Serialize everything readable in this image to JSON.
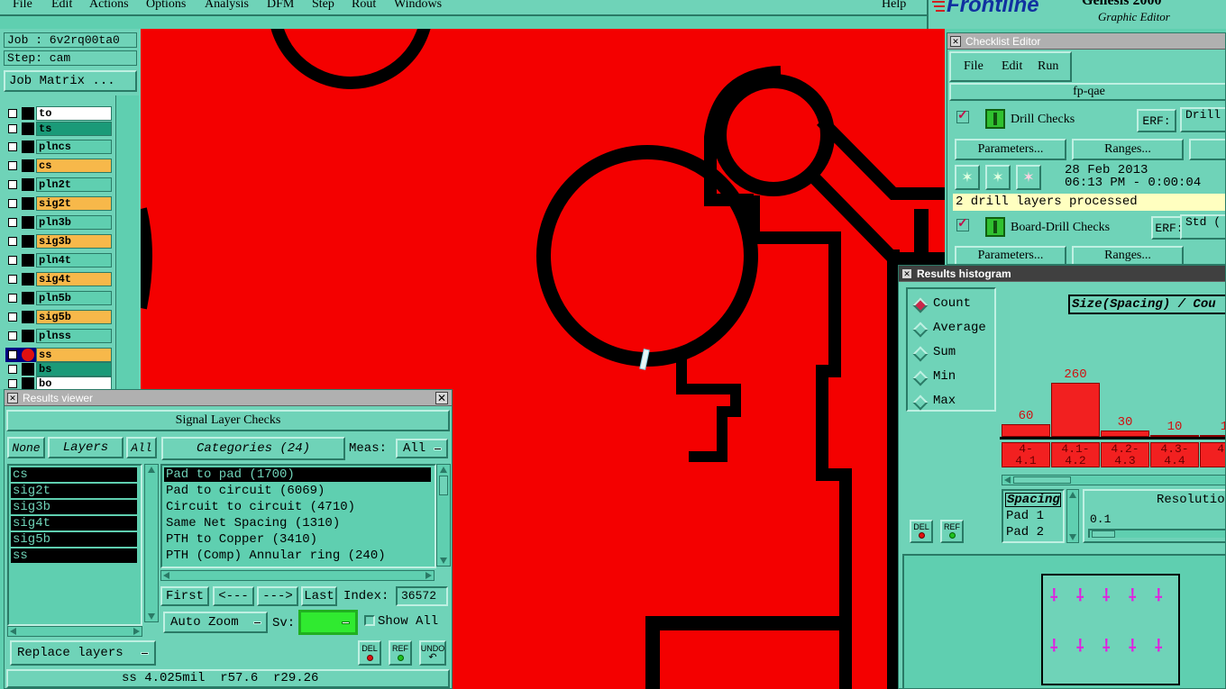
{
  "menubar": {
    "items": [
      "File",
      "Edit",
      "Actions",
      "Options",
      "Analysis",
      "DFM",
      "Step",
      "Rout",
      "Windows"
    ],
    "help": "Help"
  },
  "logo": {
    "brand": "Frontline",
    "product": "Genesis 2000",
    "subtitle": "Graphic Editor"
  },
  "left": {
    "job_label": "Job : 6v2rq00ta0",
    "step_label": "Step: cam",
    "job_matrix_button": "Job Matrix ...",
    "layers": [
      {
        "name": "to",
        "color": "#ffffff",
        "active": false
      },
      {
        "name": "ts",
        "color": "#1a9a78",
        "active": false
      },
      {
        "name": "plncs",
        "color": "#5fcfb0",
        "active": false
      },
      {
        "name": "cs",
        "color": "#f7b84a",
        "active": false
      },
      {
        "name": "pln2t",
        "color": "#5fcfb0",
        "active": false
      },
      {
        "name": "sig2t",
        "color": "#f7b84a",
        "active": false
      },
      {
        "name": "pln3b",
        "color": "#5fcfb0",
        "active": false
      },
      {
        "name": "sig3b",
        "color": "#f7b84a",
        "active": false
      },
      {
        "name": "pln4t",
        "color": "#5fcfb0",
        "active": false
      },
      {
        "name": "sig4t",
        "color": "#f7b84a",
        "active": false
      },
      {
        "name": "pln5b",
        "color": "#5fcfb0",
        "active": false
      },
      {
        "name": "sig5b",
        "color": "#f7b84a",
        "active": false
      },
      {
        "name": "plnss",
        "color": "#5fcfb0",
        "active": false
      },
      {
        "name": "ss",
        "color": "#f7b84a",
        "active": true
      },
      {
        "name": "bs",
        "color": "#1a9a78",
        "active": false
      },
      {
        "name": "bo",
        "color": "#ffffff",
        "active": false
      }
    ]
  },
  "results_viewer": {
    "title": "Results viewer",
    "check_name": "Signal Layer Checks",
    "none_btn": "None",
    "layers_btn": "Layers",
    "all_btn": "All",
    "categories_btn": "Categories (24)",
    "meas_label": "Meas:",
    "meas_value": "All",
    "layer_list": [
      "cs",
      "sig2t",
      "sig3b",
      "sig4t",
      "sig5b",
      "ss"
    ],
    "categories": [
      "Pad to pad (1700)",
      "Pad to circuit (6069)",
      "Circuit to circuit (4710)",
      "Same Net Spacing (1310)",
      "PTH to Copper (3410)",
      "PTH (Comp) Annular ring (240)"
    ],
    "first_btn": "First",
    "prev_btn": "<---",
    "next_btn": "--->",
    "last_btn": "Last",
    "index_label": "Index:",
    "index_value": "36572",
    "auto_zoom": "Auto Zoom",
    "sv_label": "Sv:",
    "show_all": "Show All",
    "replace_layers": "Replace layers",
    "del": "DEL",
    "ref": "REF",
    "undo": "UNDO",
    "status": "ss 4.025mil  r57.6  r29.26"
  },
  "checklist_editor": {
    "title": "Checklist Editor",
    "menu": [
      "File",
      "Edit",
      "Run"
    ],
    "checklist_name": "fp-qae",
    "checks": [
      {
        "name": "Drill Checks",
        "erf": "ERF:",
        "erf_value": "Drill",
        "params": "Parameters...",
        "ranges": "Ranges...",
        "date": "28 Feb 2013",
        "time": "06:13 PM - 0:00:04",
        "message": "2 drill layers processed"
      },
      {
        "name": "Board-Drill Checks",
        "erf": "ERF:",
        "erf_value": "Std (",
        "params": "Parameters...",
        "ranges": "Ranges..."
      }
    ]
  },
  "histogram": {
    "title": "Results histogram",
    "modes": [
      "Count",
      "Average",
      "Sum",
      "Min",
      "Max"
    ],
    "selected_mode": "Count",
    "chart_title": "Size(Spacing) / Cou",
    "bars": [
      {
        "label": "4-\n4.1",
        "value": 60
      },
      {
        "label": "4.1-\n4.2",
        "value": 260
      },
      {
        "label": "4.2-\n4.3",
        "value": 30
      },
      {
        "label": "4.3-\n4.4",
        "value": 10
      },
      {
        "label": "4.",
        "value": 1
      }
    ],
    "measure_list": [
      "Spacing",
      "Pad 1",
      "Pad 2"
    ],
    "resolution_label": "Resolutio",
    "resolution_value": "0.1",
    "del": "DEL",
    "ref": "REF"
  },
  "colors": {
    "background": "#5fcfb0",
    "panel": "#6fd3b8",
    "canvas": "#f40000",
    "bar": "#f22020",
    "highlight": "#ffffc0"
  }
}
